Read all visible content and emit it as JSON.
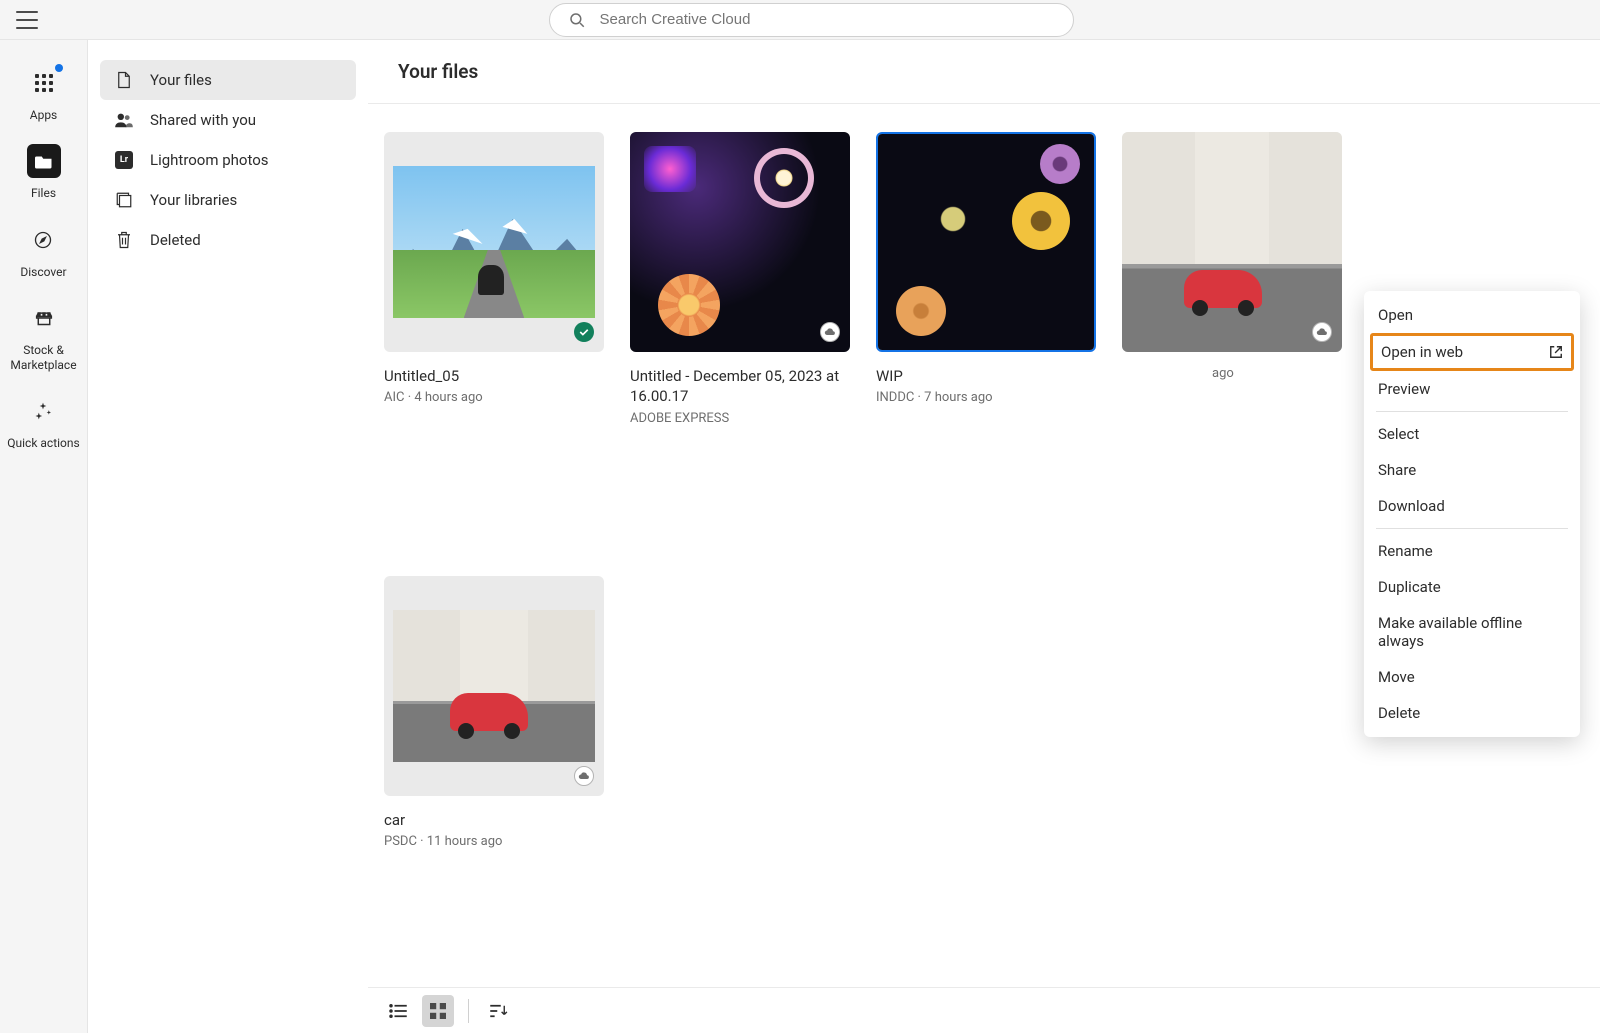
{
  "search": {
    "placeholder": "Search Creative Cloud"
  },
  "rail": [
    {
      "label": "Apps"
    },
    {
      "label": "Files"
    },
    {
      "label": "Discover"
    },
    {
      "label": "Stock & Marketplace"
    },
    {
      "label": "Quick actions"
    }
  ],
  "sidebar": [
    {
      "label": "Your files"
    },
    {
      "label": "Shared with you"
    },
    {
      "label": "Lightroom photos"
    },
    {
      "label": "Your libraries"
    },
    {
      "label": "Deleted"
    }
  ],
  "page_title": "Your files",
  "files": [
    {
      "title": "Untitled_05",
      "meta": "AIC · 4 hours ago",
      "status": "ok"
    },
    {
      "title": "Untitled - December 05, 2023 at 16.00.17",
      "meta": "ADOBE EXPRESS",
      "status": "sync"
    },
    {
      "title": "WIP",
      "meta": "INDDC · 7 hours ago",
      "status": "none",
      "selected": true
    },
    {
      "title": "",
      "meta": "ago",
      "status": "sync"
    },
    {
      "title": "car",
      "meta": "PSDC · 11 hours ago",
      "status": "sync"
    }
  ],
  "context_menu": [
    "Open",
    "Open in web",
    "Preview",
    "Select",
    "Share",
    "Download",
    "Rename",
    "Duplicate",
    "Make available offline always",
    "Move",
    "Delete"
  ],
  "highlighted_menu_item": "Open in web"
}
